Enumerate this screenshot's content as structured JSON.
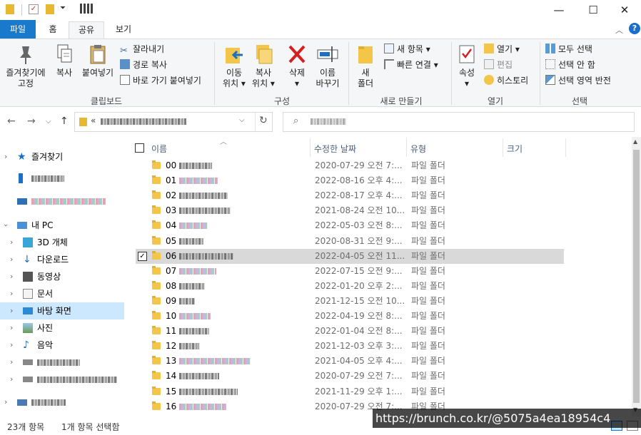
{
  "window": {
    "title_redacted": true,
    "controls": {
      "minimize": "—",
      "maximize": "☐",
      "close": "✕"
    }
  },
  "ribbon_tabs": [
    "파일",
    "홈",
    "공유",
    "보기"
  ],
  "ribbon": {
    "clipboard": {
      "pin": "즐겨찾기에\n고정",
      "copy": "복사",
      "paste": "붙여넣기",
      "cut": "잘라내기",
      "copy_path": "경로 복사",
      "paste_shortcut": "바로 가기 붙여넣기",
      "label": "클립보드"
    },
    "organize": {
      "move_to": "이동\n위치 ▾",
      "copy_to": "복사\n위치 ▾",
      "delete": "삭제\n▾",
      "rename": "이름\n바꾸기",
      "label": "구성"
    },
    "new": {
      "new_folder": "새\n폴더",
      "new_item": "새 항목 ▾",
      "easy_access": "빠른 연결 ▾",
      "label": "새로 만들기"
    },
    "open": {
      "properties": "속성\n▾",
      "open": "열기 ▾",
      "edit": "편집",
      "history": "히스토리",
      "label": "열기"
    },
    "select": {
      "select_all": "모두 선택",
      "select_none": "선택 안 함",
      "invert": "선택 영역 반전",
      "label": "선택"
    }
  },
  "address": {
    "prefix": "«"
  },
  "nav": {
    "quick_access": "즐겨찾기",
    "this_pc": "내 PC",
    "items": [
      "3D 개체",
      "다운로드",
      "동영상",
      "문서",
      "바탕 화면",
      "사진",
      "음악"
    ]
  },
  "columns": {
    "name": "이름",
    "modified": "수정한 날짜",
    "type": "유형",
    "size": "크기"
  },
  "files": [
    {
      "num": "00",
      "date": "2020-07-29 오전 7:...",
      "type": "파일 폴더"
    },
    {
      "num": "01",
      "date": "2022-08-16 오후 4:...",
      "type": "파일 폴더"
    },
    {
      "num": "02",
      "date": "2022-08-17 오후 4:...",
      "type": "파일 폴더"
    },
    {
      "num": "03",
      "date": "2021-08-24 오전 10...",
      "type": "파일 폴더"
    },
    {
      "num": "04",
      "date": "2022-05-03 오전 8:...",
      "type": "파일 폴더"
    },
    {
      "num": "05",
      "date": "2020-08-31 오전 9:...",
      "type": "파일 폴더"
    },
    {
      "num": "06",
      "date": "2022-04-05 오전 11...",
      "type": "파일 폴더"
    },
    {
      "num": "07",
      "date": "2022-07-15 오전 9:...",
      "type": "파일 폴더"
    },
    {
      "num": "08",
      "date": "2022-01-20 오후 2:...",
      "type": "파일 폴더"
    },
    {
      "num": "09",
      "date": "2021-12-15 오전 10...",
      "type": "파일 폴더"
    },
    {
      "num": "10",
      "date": "2022-04-19 오전 8:...",
      "type": "파일 폴더"
    },
    {
      "num": "11",
      "date": "2022-01-04 오전 8:...",
      "type": "파일 폴더"
    },
    {
      "num": "12",
      "date": "2021-12-03 오후 3:...",
      "type": "파일 폴더"
    },
    {
      "num": "13",
      "date": "2021-04-05 오후 4:...",
      "type": "파일 폴더"
    },
    {
      "num": "14",
      "date": "2020-07-29 오전 7:...",
      "type": "파일 폴더"
    },
    {
      "num": "15",
      "date": "2021-11-29 오후 1:...",
      "type": "파일 폴더"
    },
    {
      "num": "16",
      "date": "2020-07-29 오전 7:...",
      "type": "파일 폴더"
    }
  ],
  "selected_row_index": 6,
  "selected_row_checkmark": "✓",
  "status": {
    "count": "23개 항목",
    "selection": "1개 항목 선택함"
  },
  "watermark": "https://brunch.co.kr/@5075a4ea18954c4",
  "colors": {
    "file_tab": "#1979ca",
    "selected_nav": "#cce8ff",
    "selected_row": "#d9d9d9",
    "folder": "#f3c548"
  }
}
